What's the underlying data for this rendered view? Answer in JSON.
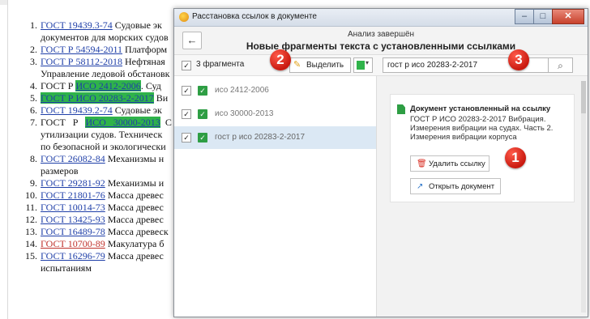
{
  "document": {
    "items": [
      {
        "num": "1.",
        "link": "ГОСТ 19439.3-74",
        "text": " Судовые эк"
      },
      {
        "num": "",
        "text": "документов для морских судов"
      },
      {
        "num": "2.",
        "link": "ГОСТ Р 54594-2011",
        "text": " Платформ"
      },
      {
        "num": "3.",
        "link": "ГОСТ Р 58112-2018",
        "text": " Нефтяная"
      },
      {
        "num": "",
        "text": "Управление ледовой обстановк"
      },
      {
        "num": "4.",
        "pre": "ГОСТ Р ",
        "link": "ИСО 2412-2006",
        "text": ". Суд"
      },
      {
        "num": "5.",
        "link": "ГОСТ Р ИСО 20283-2-2017",
        "text": " Ви"
      },
      {
        "num": "6.",
        "link": "ГОСТ 19439.2-74",
        "text": " Судовые эк"
      },
      {
        "num": "7.",
        "pre": "ГОСТ   Р   ",
        "link": "ИСО   30000-2013",
        "text": "  С"
      },
      {
        "num": "",
        "text": "утилизации судов. Техническ"
      },
      {
        "num": "",
        "text": "по безопасной и экологически"
      },
      {
        "num": "8.",
        "link": "ГОСТ 26082-84",
        "text": " Механизмы н"
      },
      {
        "num": "",
        "text": "размеров"
      },
      {
        "num": "9.",
        "link": "ГОСТ 29281-92",
        "text": " Механизмы и"
      },
      {
        "num": "10.",
        "link": "ГОСТ 21801-76",
        "text": " Масса древес"
      },
      {
        "num": "11.",
        "link": "ГОСТ 10014-73",
        "text": " Масса древес"
      },
      {
        "num": "12.",
        "link": "ГОСТ 13425-93",
        "text": " Масса древес"
      },
      {
        "num": "13.",
        "link": "ГОСТ 16489-78",
        "text": " Масса древеск"
      },
      {
        "num": "14.",
        "link": "ГОСТ 10700-89",
        "text": " Макулатура б"
      },
      {
        "num": "15.",
        "link": "ГОСТ 16296-79",
        "text": " Масса древес"
      },
      {
        "num": "",
        "text": "испытаниям"
      }
    ]
  },
  "dialog": {
    "window_title": "Расстановка ссылок в документе",
    "controls": {
      "minimize": "–",
      "maximize": "□",
      "close": "✕"
    },
    "back_glyph": "←",
    "status": "Анализ завершён",
    "title": "Новые фрагменты текста с установленными ссылками",
    "toolbar": {
      "fragments_count": "3 фрагмента",
      "select_label": "Выделить",
      "highlight_color": "#2fb34a",
      "search_value": "гост р исо 20283-2-2017",
      "search_icon": "search-icon"
    },
    "fragments": [
      {
        "label": "исо 2412-2006",
        "checked": true,
        "selected": false
      },
      {
        "label": "исо 30000-2013",
        "checked": true,
        "selected": false
      },
      {
        "label": "гост р исо 20283-2-2017",
        "checked": true,
        "selected": true
      }
    ],
    "detail": {
      "heading": "Документ установленный на ссылку",
      "description": "ГОСТ Р ИСО 20283-2-2017 Вибрация. Измерения вибрации на судах. Часть 2. Измерения вибрации корпуса",
      "delete_label": "Удалить ссылку",
      "open_label": "Открыть документ"
    }
  },
  "callouts": [
    "1",
    "2",
    "3"
  ],
  "colors": {
    "accent_green": "#2e9e44",
    "callout_red": "#d8261b",
    "link_blue": "#1f3fa8"
  }
}
